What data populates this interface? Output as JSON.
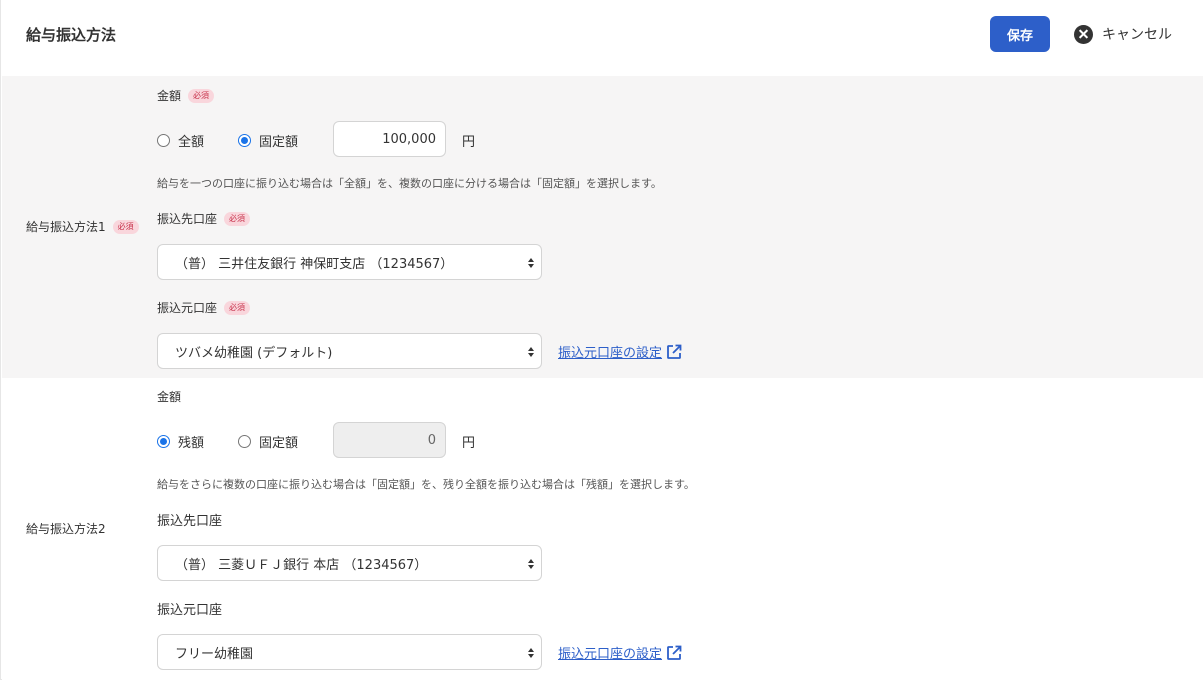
{
  "header": {
    "title": "給与振込方法",
    "save_label": "保存",
    "cancel_label": "キャンセル"
  },
  "required_badge": "必須",
  "method1": {
    "row_label": "給与振込方法1",
    "amount_label": "金額",
    "radio_all_label": "全額",
    "radio_fixed_label": "固定額",
    "selected": "固定額",
    "amount_value": "100,000",
    "unit": "円",
    "help_text": "給与を一つの口座に振り込む場合は「全額」を、複数の口座に分ける場合は「固定額」を選択します。",
    "dest_label": "振込先口座",
    "dest_value": "（普） 三井住友銀行 神保町支店 （1234567）",
    "source_label": "振込元口座",
    "source_value": "ツバメ幼稚園 (デフォルト)",
    "source_link": "振込元口座の設定"
  },
  "method2": {
    "row_label": "給与振込方法2",
    "amount_label": "金額",
    "radio_rest_label": "残額",
    "radio_fixed_label": "固定額",
    "selected": "残額",
    "amount_value": "0",
    "unit": "円",
    "help_text": "給与をさらに複数の口座に振り込む場合は「固定額」を、残り全額を振り込む場合は「残額」を選択します。",
    "dest_label": "振込先口座",
    "dest_value": "（普） 三菱ＵＦＪ銀行 本店 （1234567）",
    "source_label": "振込元口座",
    "source_value": "フリー幼稚園",
    "source_link": "振込元口座の設定"
  },
  "colors": {
    "primary": "#2d5fc9",
    "required_bg": "#f9d6dc",
    "required_text": "#c8344d",
    "section_bg": "#f6f5f5"
  }
}
